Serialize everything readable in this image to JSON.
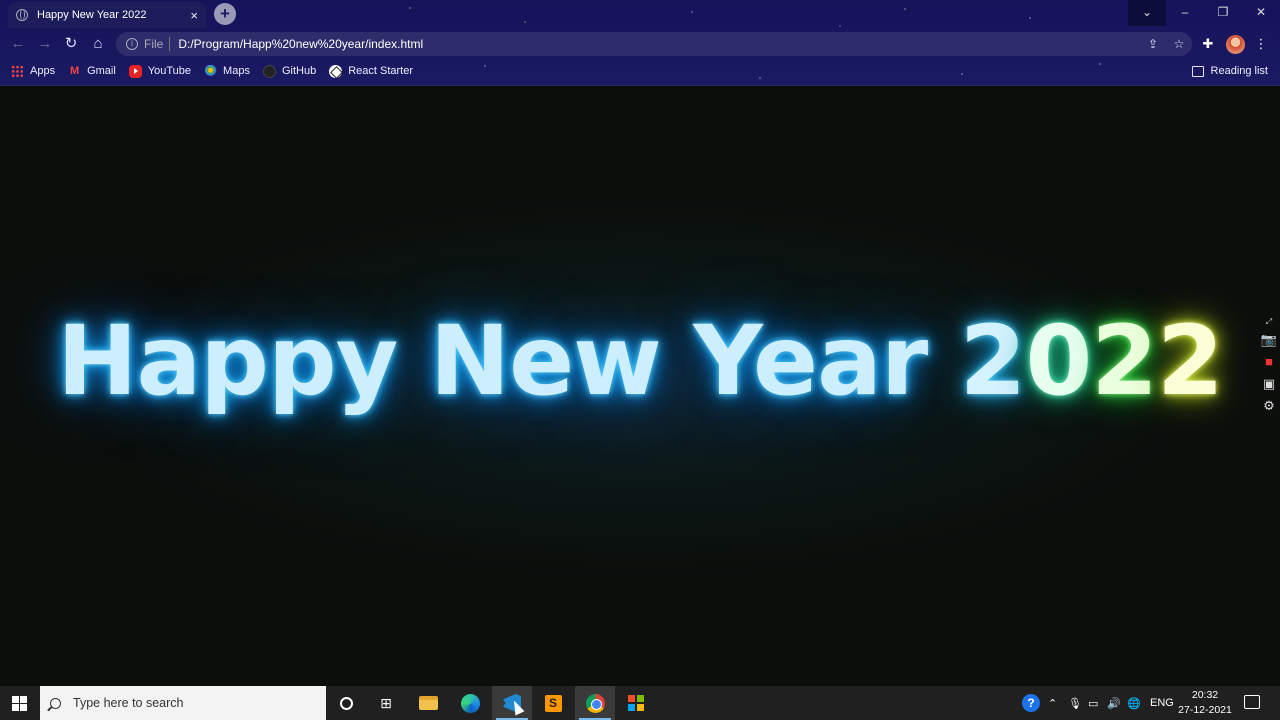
{
  "browser": {
    "tab_title": "Happy New Year 2022",
    "tab_close": "×",
    "new_tab": "+",
    "window_controls": {
      "dropdown": "⌄",
      "minimize": "–",
      "restore": "❐",
      "close": "✕"
    },
    "address": {
      "scheme": "File",
      "url": "D:/Program/Happ%20new%20year/index.html"
    },
    "bookmarks": [
      {
        "label": "Apps",
        "icon": "apps-grid-icon"
      },
      {
        "label": "Gmail",
        "icon": "gmail-icon"
      },
      {
        "label": "YouTube",
        "icon": "youtube-icon"
      },
      {
        "label": "Maps",
        "icon": "maps-icon"
      },
      {
        "label": "GitHub",
        "icon": "github-icon"
      },
      {
        "label": "React Starter",
        "icon": "react-starter-icon"
      }
    ],
    "reading_list": "Reading list"
  },
  "page": {
    "greeting_words": "Happy New Year",
    "year_digits": [
      "2",
      "0",
      "2",
      "2"
    ],
    "glow_colors": {
      "text": "#5ed0ff",
      "digit_1": "#20b0e8",
      "digit_2": "#2ad098",
      "digit_3": "#30d040",
      "digit_4": "#b8d020"
    }
  },
  "taskbar": {
    "search_placeholder": "Type here to search",
    "language": "ENG",
    "time": "20:32",
    "date": "27-12-2021"
  }
}
